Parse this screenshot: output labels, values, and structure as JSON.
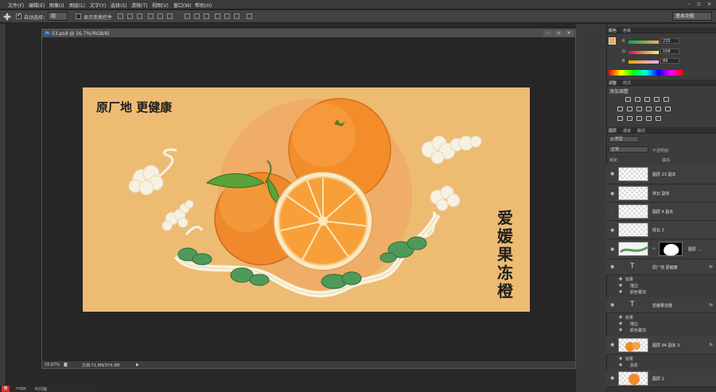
{
  "menubar": {
    "items": [
      "文件(F)",
      "编辑(E)",
      "图像(I)",
      "图层(L)",
      "文字(Y)",
      "选择(S)",
      "滤镜(T)",
      "视图(V)",
      "窗口(W)",
      "帮助(H)"
    ]
  },
  "options": {
    "auto_select_label": "自动选择：",
    "auto_select_value": "组",
    "show_transform_label": "显示变换控件",
    "workspace": "基本功能"
  },
  "document": {
    "title": "53.psd @ 16.7%(RGB/8)",
    "zoom": "16.67%",
    "doc_info": "文档:71.8M/374.9M"
  },
  "artwork": {
    "slogan": "原厂地 更健康",
    "vertical_title": [
      "爱",
      "媛",
      "果",
      "冻",
      "橙"
    ]
  },
  "color_panel": {
    "tabs": [
      "颜色",
      "色板"
    ],
    "r": "235",
    "g": "168",
    "b": "89",
    "r_label": "R",
    "g_label": "G",
    "b_label": "B",
    "foreground": "#eba859"
  },
  "adjustments_panel": {
    "tabs": [
      "调整",
      "样式"
    ],
    "add_label": "添加调整"
  },
  "layers_panel": {
    "tabs": [
      "图层",
      "通道",
      "路径"
    ],
    "filter": "ρ 类型",
    "blend_mode": "正常",
    "opacity_label": "不透明度:",
    "lock_label": "锁定:",
    "fill_label": "填充:",
    "layers": [
      {
        "name": "图层 23 副本",
        "kind": "pixel"
      },
      {
        "name": "祥云 副本",
        "kind": "pixel"
      },
      {
        "name": "图层 4 副本",
        "kind": "pixel"
      },
      {
        "name": "祥云 2",
        "kind": "pixel"
      },
      {
        "name": "图层 ...",
        "kind": "masked"
      },
      {
        "name": "原厂地 更健康",
        "kind": "text",
        "effects_label": "效果",
        "effects": [
          "描边",
          "颜色叠加"
        ]
      },
      {
        "name": "爱媛果冻橙",
        "kind": "text",
        "effects_label": "效果",
        "effects": [
          "描边",
          "颜色叠加"
        ]
      },
      {
        "name": "图层 94 副本 3",
        "kind": "orange",
        "effects_label": "效果",
        "effects": [
          "投影"
        ]
      },
      {
        "name": "图层 1",
        "kind": "orange"
      }
    ]
  },
  "taskbar": {
    "items": [
      "ridge",
      "时间轴"
    ]
  }
}
